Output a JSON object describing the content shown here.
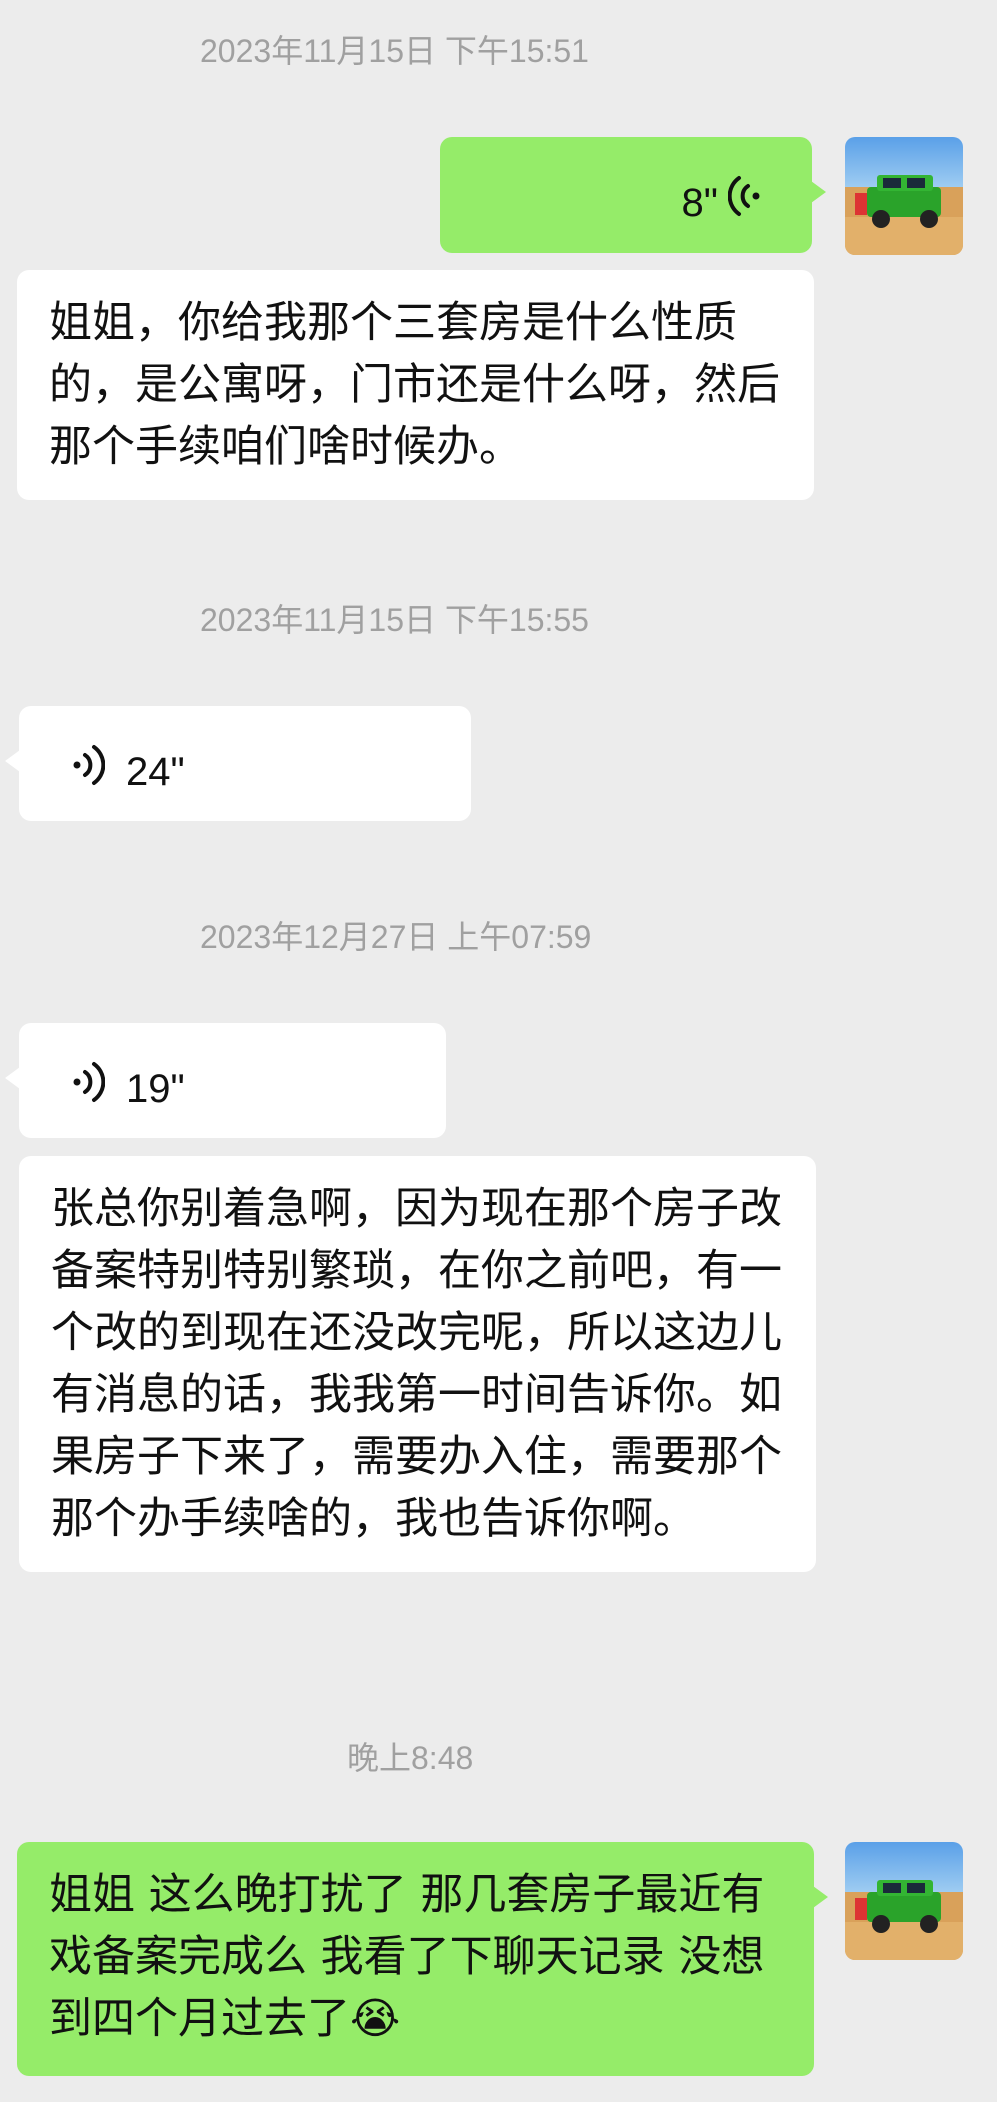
{
  "messages": {
    "ts1": "2023年11月15日 下午15:51",
    "msg1_duration": "8\"",
    "msg2_text": "姐姐，你给我那个三套房是什么性质的，是公寓呀，门市还是什么呀，然后那个手续咱们啥时候办。",
    "ts2": "2023年11月15日 下午15:55",
    "msg3_duration": "24\"",
    "ts3": "2023年12月27日 上午07:59",
    "msg4_duration": "19\"",
    "msg5_text": "张总你别着急啊，因为现在那个房子改备案特别特别繁琐，在你之前吧，有一个改的到现在还没改完呢，所以这边儿有消息的话，我我第一时间告诉你。如果房子下来了，需要办入住，需要那个那个办手续啥的，我也告诉你啊。",
    "ts4": "晚上8:48",
    "msg6_text": "姐姐 这么晚打扰了 那几套房子最近有戏备案完成么 我看了下聊天记录 没想到四个月过去了😭"
  },
  "colors": {
    "sent_bubble": "#95ec69",
    "received_bubble": "#ffffff",
    "background": "#ececec",
    "timestamp": "#a0a0a0"
  },
  "icons": {
    "voice": "voice-wave-icon",
    "avatar": "green-suv-in-desert"
  }
}
